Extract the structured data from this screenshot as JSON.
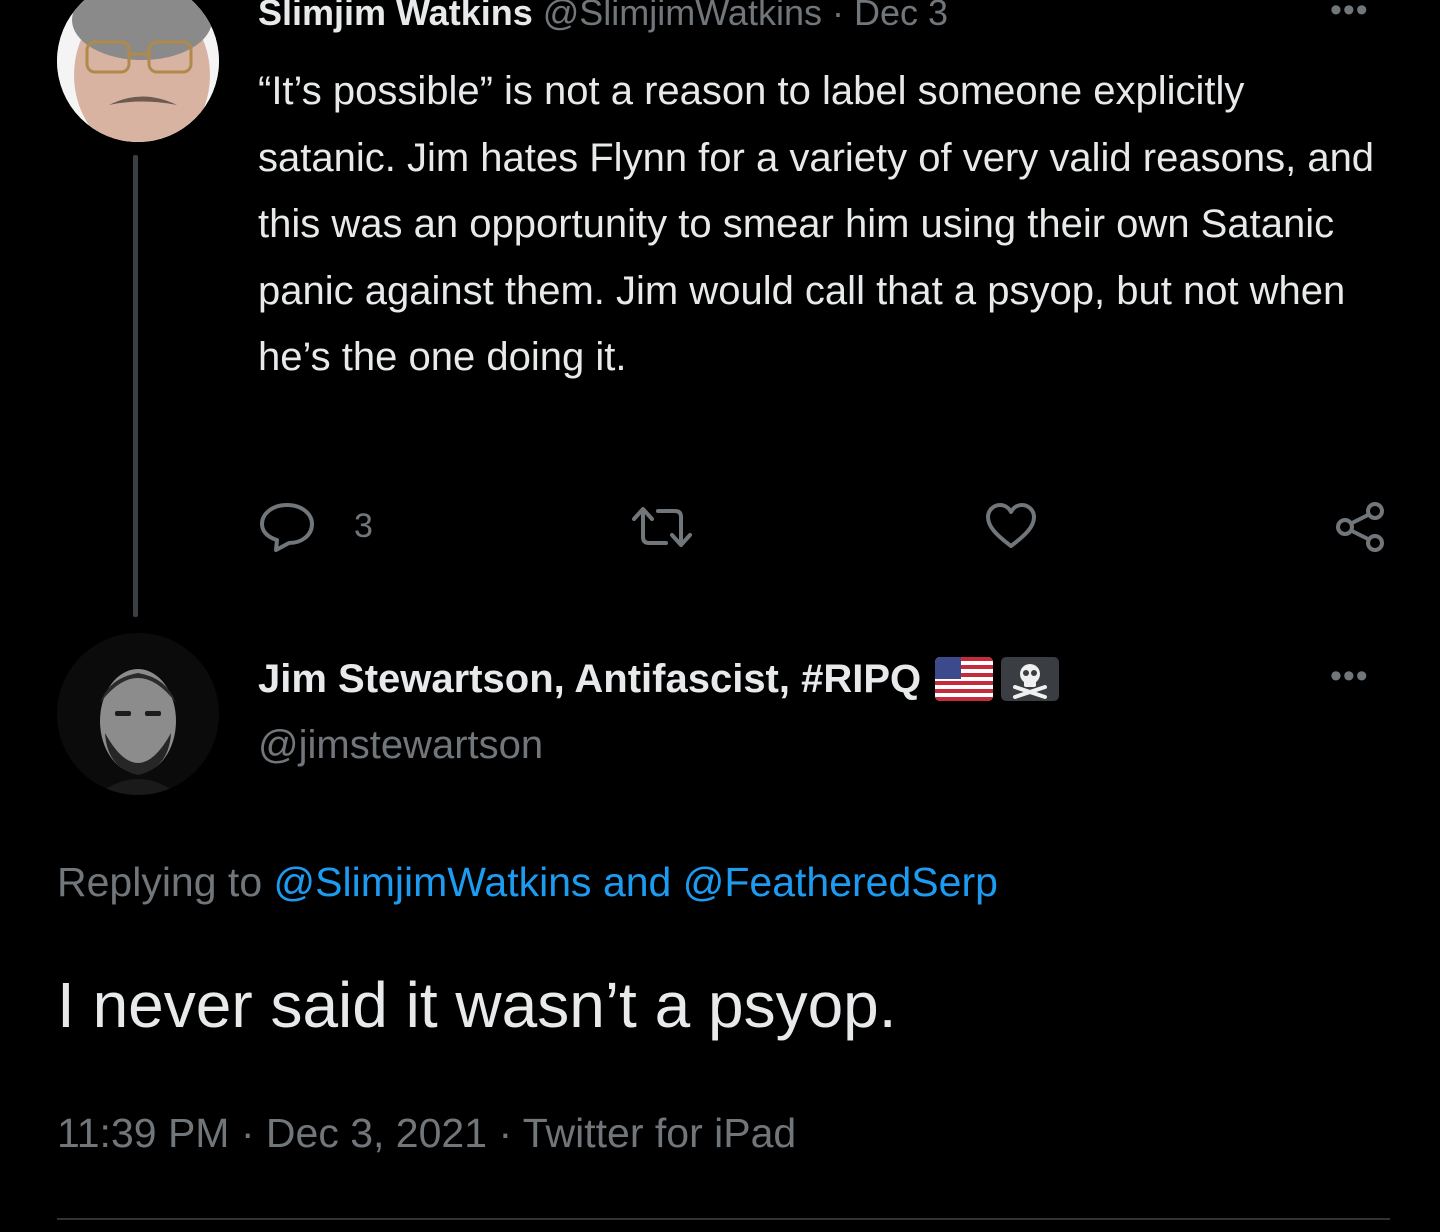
{
  "parent_tweet": {
    "author_name": "Slimjim Watkins",
    "author_handle": "@SlimjimWatkins",
    "separator": "·",
    "date": "Dec 3",
    "more_glyph": "•••",
    "text": "“It’s possible” is not a reason to label someone explicitly satanic. Jim hates Flynn for a variety of very valid reasons, and this was an opportunity to smear him using their own Satanic panic against them. Jim would call that a psyop, but not when he’s the one doing it.",
    "actions": {
      "reply_count": "3",
      "reply_icon": "reply-bubble-icon",
      "retweet_icon": "retweet-icon",
      "like_icon": "heart-icon",
      "share_icon": "share-icon"
    }
  },
  "main_tweet": {
    "author_name": "Jim Stewartson, Antifascist, #RIPQ",
    "author_handle": "@jimstewartson",
    "badges": [
      "us-flag-emoji-icon",
      "skull-crossbones-flag-icon"
    ],
    "more_glyph": "•••",
    "replying_prefix": "Replying to",
    "replying_user_1": "@SlimjimWatkins",
    "replying_and": "and",
    "replying_user_2": "@FeatheredSerp",
    "text": "I never said it wasn’t a psyop.",
    "time": "11:39 PM",
    "date": "Dec 3, 2021",
    "source": "Twitter for iPad",
    "separator": "·"
  },
  "colors": {
    "background": "#000000",
    "text": "#e7e9ea",
    "muted": "#71767b",
    "link": "#1d9bf0",
    "divider": "#2f3336"
  }
}
